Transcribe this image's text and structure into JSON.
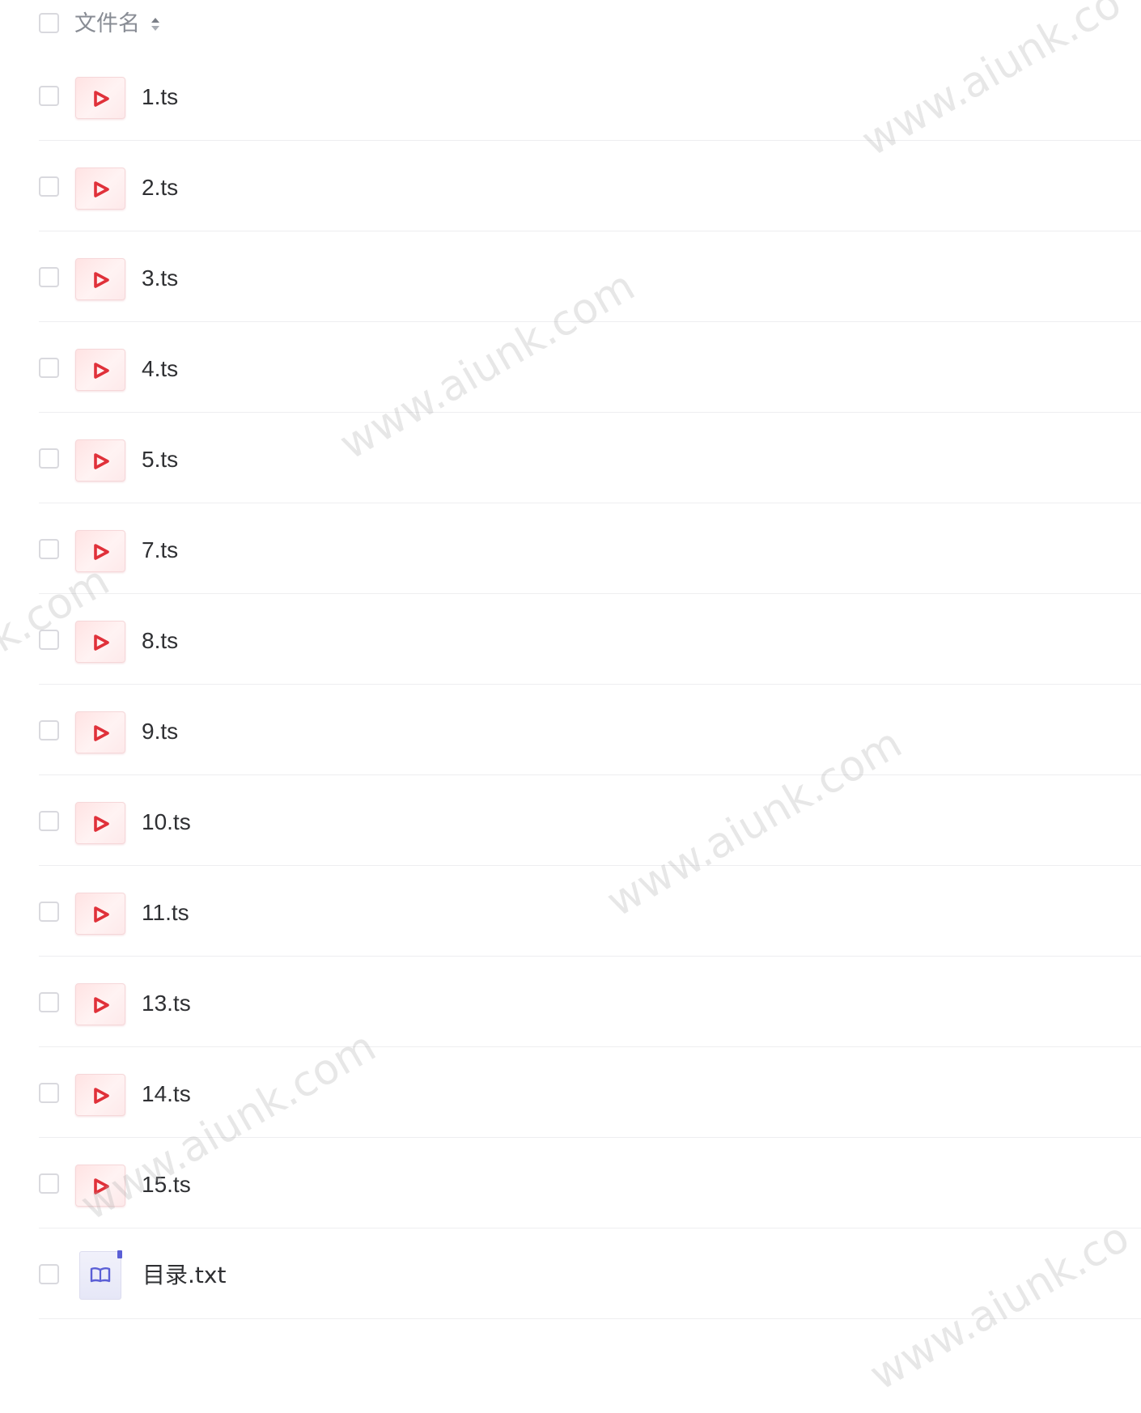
{
  "header": {
    "column_label": "文件名",
    "sort_icon": "sort-icon"
  },
  "files": [
    {
      "name": "1.ts",
      "type": "video"
    },
    {
      "name": "2.ts",
      "type": "video"
    },
    {
      "name": "3.ts",
      "type": "video"
    },
    {
      "name": "4.ts",
      "type": "video"
    },
    {
      "name": "5.ts",
      "type": "video"
    },
    {
      "name": "7.ts",
      "type": "video"
    },
    {
      "name": "8.ts",
      "type": "video"
    },
    {
      "name": "9.ts",
      "type": "video"
    },
    {
      "name": "10.ts",
      "type": "video"
    },
    {
      "name": "11.ts",
      "type": "video"
    },
    {
      "name": "13.ts",
      "type": "video"
    },
    {
      "name": "14.ts",
      "type": "video"
    },
    {
      "name": "15.ts",
      "type": "video"
    },
    {
      "name": "目录.txt",
      "type": "document"
    }
  ],
  "watermark": {
    "text": "www.aiunk.com",
    "partial_left": "nk.com",
    "partial_right": "www.aiunk.co"
  },
  "colors": {
    "video_accent": "#e0313a",
    "document_accent": "#5b5fd6",
    "text": "#2f3033",
    "header_text": "#888c94"
  }
}
